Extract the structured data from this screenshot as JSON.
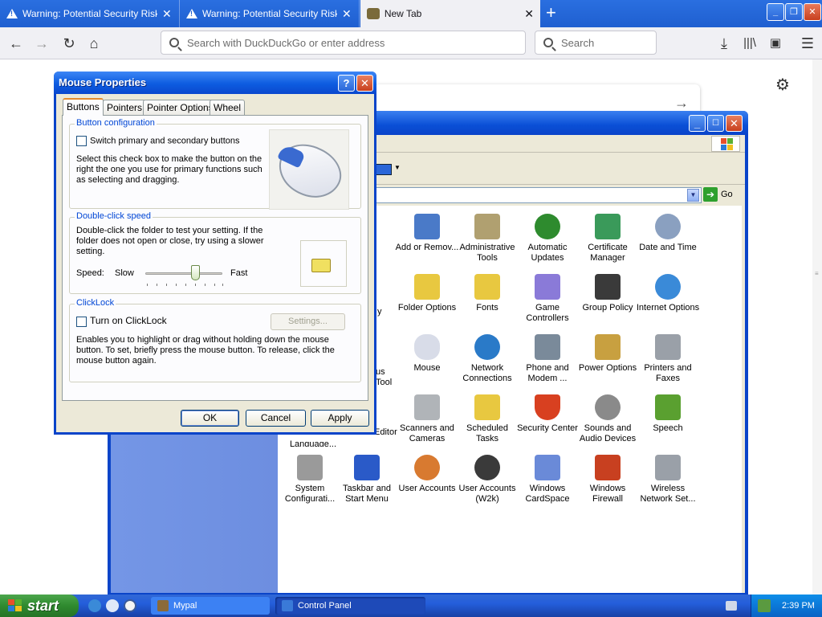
{
  "browser": {
    "tabs": [
      {
        "title": "Warning: Potential Security Risk Ah",
        "icon": "warning-icon"
      },
      {
        "title": "Warning: Potential Security Risk Ah",
        "icon": "warning-icon"
      },
      {
        "title": "New Tab",
        "icon": "newtab-icon"
      }
    ],
    "address_placeholder": "Search with DuckDuckGo or enter address",
    "search_placeholder": "Search"
  },
  "mouse_dialog": {
    "title": "Mouse Properties",
    "help_glyph": "?",
    "close_glyph": "✕",
    "tabs": [
      "Buttons",
      "Pointers",
      "Pointer Options",
      "Wheel"
    ],
    "button_config": {
      "label": "Button configuration",
      "checkbox_label": "Switch primary and secondary buttons",
      "description": "Select this check box to make the button on the right the one you use for primary functions such as selecting and dragging."
    },
    "double_click": {
      "label": "Double-click speed",
      "description": "Double-click the folder to test your setting. If the folder does not open or close, try using a slower setting.",
      "speed_label": "Speed:",
      "slow_label": "Slow",
      "fast_label": "Fast",
      "speed_fraction": 0.65
    },
    "clicklock": {
      "label": "ClickLock",
      "checkbox_label": "Turn on ClickLock",
      "settings_label": "Settings...",
      "description": "Enables you to highlight or drag without holding down the mouse button. To set, briefly press the mouse button. To release, click the mouse button again."
    },
    "buttons": {
      "ok": "OK",
      "cancel": "Cancel",
      "apply": "Apply"
    }
  },
  "control_panel": {
    "go_label": "Go",
    "partial_labels": [
      "ware",
      "y",
      "us",
      "Tool",
      "Editor",
      "Language..."
    ],
    "items": [
      {
        "label": "Add or Remov...",
        "icon": "add-remove-programs-icon",
        "color": "#4a7ac8"
      },
      {
        "label": "Administrative Tools",
        "icon": "administrative-tools-icon",
        "color": "#b0a070"
      },
      {
        "label": "Automatic Updates",
        "icon": "windows-update-icon",
        "color": "#2e8b2e"
      },
      {
        "label": "Certificate Manager",
        "icon": "certificate-icon",
        "color": "#3a9a5a"
      },
      {
        "label": "Date and Time",
        "icon": "clock-icon",
        "color": "#8aa0c0"
      },
      {
        "label": "Folder Options",
        "icon": "folder-options-icon",
        "color": "#e8c840"
      },
      {
        "label": "Fonts",
        "icon": "fonts-folder-icon",
        "color": "#e8c840"
      },
      {
        "label": "Game Controllers",
        "icon": "gamepad-icon",
        "color": "#8a7ad8"
      },
      {
        "label": "Group Policy",
        "icon": "group-policy-icon",
        "color": "#3a3a3a"
      },
      {
        "label": "Internet Options",
        "icon": "internet-globe-icon",
        "color": "#3a8ad8"
      },
      {
        "label": "Mouse",
        "icon": "mouse-icon",
        "color": "#d8dce8"
      },
      {
        "label": "Network Connections",
        "icon": "network-globe-icon",
        "color": "#2a7ac8"
      },
      {
        "label": "Phone and Modem ...",
        "icon": "phone-icon",
        "color": "#7a8a9a"
      },
      {
        "label": "Power Options",
        "icon": "power-icon",
        "color": "#c8a040"
      },
      {
        "label": "Printers and Faxes",
        "icon": "printer-icon",
        "color": "#9aa0a8"
      },
      {
        "label": "Scanners and Cameras",
        "icon": "scanner-icon",
        "color": "#b0b4b8"
      },
      {
        "label": "Scheduled Tasks",
        "icon": "scheduled-tasks-icon",
        "color": "#e8c840"
      },
      {
        "label": "Security Center",
        "icon": "security-shield-icon",
        "color": "#d84020"
      },
      {
        "label": "Sounds and Audio Devices",
        "icon": "speaker-icon",
        "color": "#8a8a8a"
      },
      {
        "label": "Speech",
        "icon": "speech-icon",
        "color": "#5aa030"
      },
      {
        "label": "System Configurati...",
        "icon": "system-config-icon",
        "color": "#9a9a9a"
      },
      {
        "label": "Taskbar and Start Menu",
        "icon": "taskbar-icon",
        "color": "#2a5ac8"
      },
      {
        "label": "User Accounts",
        "icon": "user-accounts-icon",
        "color": "#d87a30"
      },
      {
        "label": "User Accounts (W2k)",
        "icon": "user-accounts-key-icon",
        "color": "#3a3a3a"
      },
      {
        "label": "Windows CardSpace",
        "icon": "cardspace-icon",
        "color": "#6a8ad8"
      },
      {
        "label": "Windows Firewall",
        "icon": "firewall-icon",
        "color": "#c84020"
      },
      {
        "label": "Wireless Network Set...",
        "icon": "wireless-icon",
        "color": "#9aa0a8"
      }
    ]
  },
  "taskbar": {
    "start_label": "start",
    "items": [
      {
        "label": "Mypal",
        "icon": "mypal-icon"
      },
      {
        "label": "Control Panel",
        "icon": "control-panel-icon"
      }
    ],
    "clock": "2:39 PM"
  }
}
